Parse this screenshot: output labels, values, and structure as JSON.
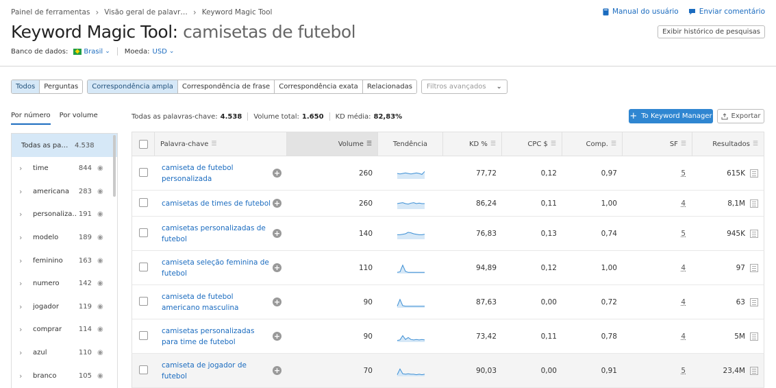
{
  "breadcrumb": [
    "Painel de ferramentas",
    "Visão geral de palavr…",
    "Keyword Magic Tool"
  ],
  "top_links": {
    "manual": "Manual do usuário",
    "feedback": "Enviar comentário"
  },
  "title": {
    "tool": "Keyword Magic Tool:",
    "query": "camisetas de futebol"
  },
  "history_button": "Exibir histórico de pesquisas",
  "database": {
    "label": "Banco de dados:",
    "value": "Brasil",
    "currency_label": "Moeda:",
    "currency_value": "USD"
  },
  "filters": {
    "group1": [
      "Todos",
      "Perguntas"
    ],
    "group2": [
      "Correspondência ampla",
      "Correspondência de frase",
      "Correspondência exata",
      "Relacionadas"
    ],
    "advanced_placeholder": "Filtros avançados"
  },
  "side_tabs": [
    "Por número",
    "Por volume"
  ],
  "sidebar": {
    "all_label": "Todas as pa…",
    "all_count": "4.538",
    "items": [
      {
        "name": "time",
        "count": "844"
      },
      {
        "name": "americana",
        "count": "283"
      },
      {
        "name": "personaliza…",
        "count": "191"
      },
      {
        "name": "modelo",
        "count": "189"
      },
      {
        "name": "feminino",
        "count": "163"
      },
      {
        "name": "numero",
        "count": "142"
      },
      {
        "name": "jogador",
        "count": "119"
      },
      {
        "name": "comprar",
        "count": "114"
      },
      {
        "name": "azul",
        "count": "110"
      },
      {
        "name": "branco",
        "count": "105"
      }
    ]
  },
  "stats": {
    "all_label": "Todas as palavras-chave:",
    "all_value": "4.538",
    "volume_label": "Volume total:",
    "volume_value": "1.650",
    "kd_label": "KD média:",
    "kd_value": "82,83%"
  },
  "buttons": {
    "keyword_manager": "To Keyword Manager",
    "export": "Exportar"
  },
  "table": {
    "headers": [
      "Palavra-chave",
      "Volume",
      "Tendência",
      "KD %",
      "CPC $",
      "Comp.",
      "SF",
      "Resultados"
    ],
    "rows": [
      {
        "keyword": "camiseta de futebol personalizada",
        "volume": "260",
        "kd": "77,72",
        "cpc": "0,12",
        "comp": "0,97",
        "sf": "5",
        "results": "615K",
        "trend": [
          0.5,
          0.55,
          0.5,
          0.45,
          0.5,
          0.55,
          0.5,
          0.45,
          0.5,
          0.6,
          0.3
        ]
      },
      {
        "keyword": "camisetas de times de futebol",
        "volume": "260",
        "kd": "86,24",
        "cpc": "0,11",
        "comp": "1,00",
        "sf": "4",
        "results": "8,1M",
        "trend": [
          0.5,
          0.45,
          0.4,
          0.5,
          0.55,
          0.45,
          0.4,
          0.5,
          0.45,
          0.5,
          0.5
        ]
      },
      {
        "keyword": "camisetas personalizadas de futebol",
        "volume": "140",
        "kd": "76,83",
        "cpc": "0,13",
        "comp": "0,74",
        "sf": "5",
        "results": "945K",
        "trend": [
          0.6,
          0.6,
          0.55,
          0.5,
          0.35,
          0.4,
          0.5,
          0.55,
          0.6,
          0.6,
          0.55
        ]
      },
      {
        "keyword": "camiseta seleção feminina de futebol",
        "volume": "110",
        "kd": "94,89",
        "cpc": "0,12",
        "comp": "1,00",
        "sf": "4",
        "results": "97",
        "trend": [
          0.95,
          0.9,
          0.2,
          0.85,
          0.95,
          0.95,
          0.95,
          0.95,
          0.95,
          0.95,
          0.95
        ]
      },
      {
        "keyword": "camiseta de futebol americano masculina",
        "volume": "90",
        "kd": "87,63",
        "cpc": "0,00",
        "comp": "0,72",
        "sf": "4",
        "results": "63",
        "trend": [
          0.9,
          0.2,
          0.85,
          0.9,
          0.9,
          0.9,
          0.9,
          0.9,
          0.9,
          0.9,
          0.9
        ]
      },
      {
        "keyword": "camisetas personalizadas para time de futebol",
        "volume": "90",
        "kd": "73,42",
        "cpc": "0,11",
        "comp": "0,78",
        "sf": "4",
        "results": "5M",
        "trend": [
          0.9,
          0.85,
          0.4,
          0.8,
          0.6,
          0.8,
          0.85,
          0.8,
          0.85,
          0.8,
          0.85
        ]
      },
      {
        "keyword": "camiseta de jogador de futebol",
        "volume": "70",
        "kd": "90,03",
        "cpc": "0,00",
        "comp": "0,91",
        "sf": "5",
        "results": "23,4M",
        "trend": [
          0.9,
          0.3,
          0.8,
          0.85,
          0.8,
          0.85,
          0.85,
          0.9,
          0.85,
          0.9,
          0.85
        ]
      }
    ]
  },
  "colors": {
    "accent": "#2f86d1",
    "link": "#1a6bbf",
    "active_bg": "#d6e8f7"
  }
}
